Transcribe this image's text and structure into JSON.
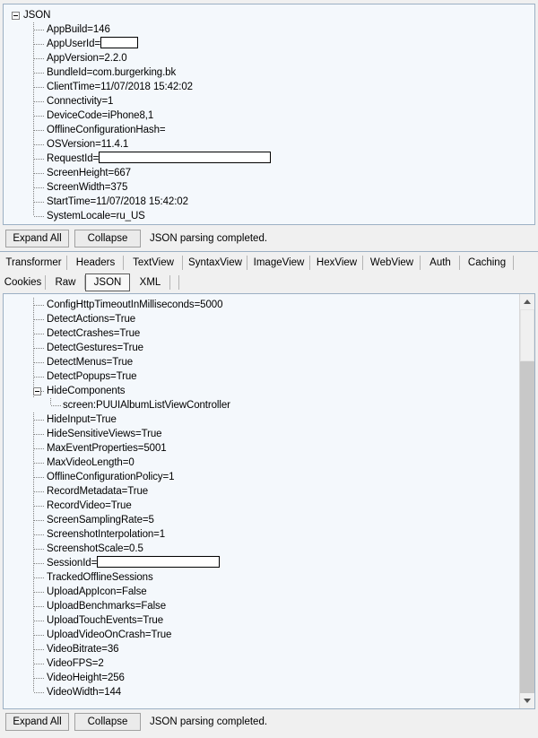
{
  "top_panel": {
    "root": {
      "label": "JSON",
      "expander": "collapse-minus"
    },
    "nodes": [
      {
        "text": "AppBuild=146"
      },
      {
        "text": "AppUserId=",
        "redacted": true,
        "redact_width": 42
      },
      {
        "text": "AppVersion=2.2.0"
      },
      {
        "text": "BundleId=com.burgerking.bk"
      },
      {
        "text": "ClientTime=11/07/2018 15:42:02"
      },
      {
        "text": "Connectivity=1"
      },
      {
        "text": "DeviceCode=iPhone8,1"
      },
      {
        "text": "OfflineConfigurationHash="
      },
      {
        "text": "OSVersion=11.4.1"
      },
      {
        "text": "RequestId=",
        "redacted": true,
        "redact_width": 192
      },
      {
        "text": "ScreenHeight=667"
      },
      {
        "text": "ScreenWidth=375"
      },
      {
        "text": "StartTime=11/07/2018 15:42:02"
      },
      {
        "text": "SystemLocale=ru_US"
      }
    ]
  },
  "top_toolbar": {
    "expand_all_label": "Expand All",
    "collapse_label": "Collapse",
    "status": "JSON parsing completed."
  },
  "tabs": {
    "row1": [
      {
        "label": "Transformer",
        "selected": false
      },
      {
        "label": "Headers",
        "selected": false
      },
      {
        "label": "TextView",
        "selected": false
      },
      {
        "label": "SyntaxView",
        "selected": false
      },
      {
        "label": "ImageView",
        "selected": false
      },
      {
        "label": "HexView",
        "selected": false
      },
      {
        "label": "WebView",
        "selected": false
      },
      {
        "label": "Auth",
        "selected": false
      },
      {
        "label": "Caching",
        "selected": false
      }
    ],
    "row2": [
      {
        "label": "Cookies",
        "selected": false
      },
      {
        "label": "Raw",
        "selected": false
      },
      {
        "label": "JSON",
        "selected": true
      },
      {
        "label": "XML",
        "selected": false
      }
    ]
  },
  "bottom_panel": {
    "nodes": [
      {
        "text": "ConfigHttpTimeoutInMilliseconds=5000"
      },
      {
        "text": "DetectActions=True"
      },
      {
        "text": "DetectCrashes=True"
      },
      {
        "text": "DetectGestures=True"
      },
      {
        "text": "DetectMenus=True"
      },
      {
        "text": "DetectPopups=True"
      },
      {
        "text": "HideComponents",
        "expandable": true
      },
      {
        "text": "screen:PUUIAlbumListViewController",
        "child": true
      },
      {
        "text": "HideInput=True"
      },
      {
        "text": "HideSensitiveViews=True"
      },
      {
        "text": "MaxEventProperties=5001"
      },
      {
        "text": "MaxVideoLength=0"
      },
      {
        "text": "OfflineConfigurationPolicy=1"
      },
      {
        "text": "RecordMetadata=True"
      },
      {
        "text": "RecordVideo=True"
      },
      {
        "text": "ScreenSamplingRate=5"
      },
      {
        "text": "ScreenshotInterpolation=1"
      },
      {
        "text": "ScreenshotScale=0.5"
      },
      {
        "text": "SessionId=",
        "redacted": true,
        "redact_width": 137
      },
      {
        "text": "TrackedOfflineSessions"
      },
      {
        "text": "UploadAppIcon=False"
      },
      {
        "text": "UploadBenchmarks=False"
      },
      {
        "text": "UploadTouchEvents=True"
      },
      {
        "text": "UploadVideoOnCrash=True"
      },
      {
        "text": "VideoBitrate=36"
      },
      {
        "text": "VideoFPS=2"
      },
      {
        "text": "VideoHeight=256"
      },
      {
        "text": "VideoWidth=144"
      }
    ],
    "scrollbar": {
      "up_icon": "chevron-up-icon",
      "down_icon": "chevron-down-icon",
      "thumb_position_pct": 0,
      "thumb_size_pct": 14
    }
  },
  "bottom_toolbar": {
    "expand_all_label": "Expand All",
    "collapse_label": "Collapse",
    "status": "JSON parsing completed."
  },
  "colors": {
    "panel_background": "#f4f8fc",
    "panel_border": "#9cb0c4",
    "chrome_background": "#f0f0f0",
    "button_face": "#ebebeb",
    "scroll_track": "#c8c8c8"
  }
}
